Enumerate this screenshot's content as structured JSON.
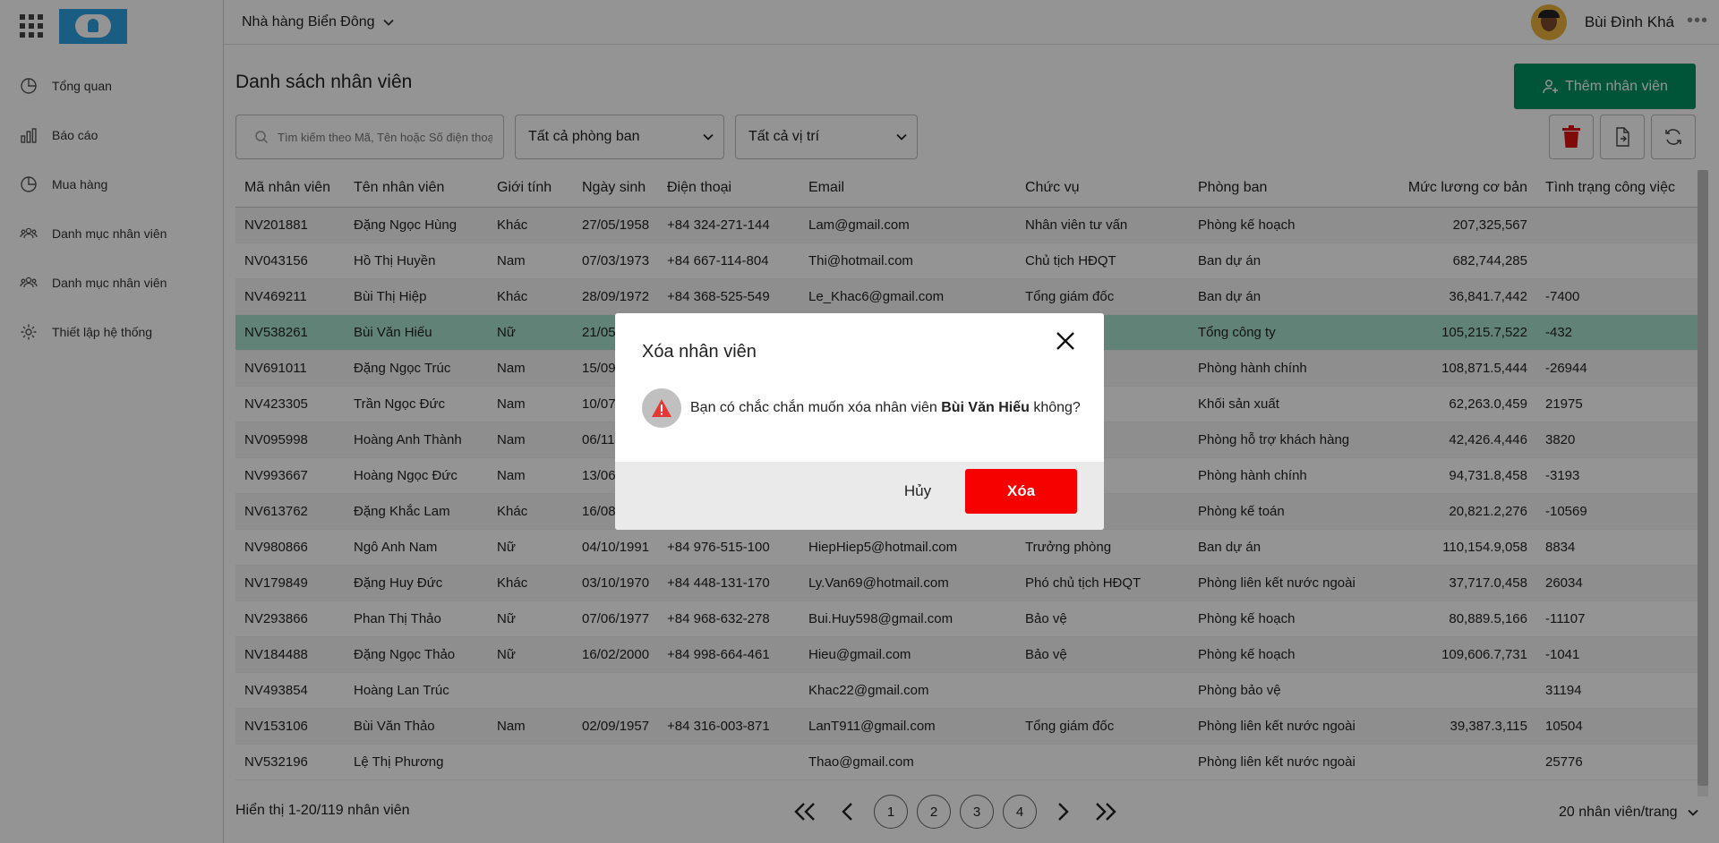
{
  "sidebar": {
    "items": [
      {
        "label": "Tổng quan",
        "icon": "pie-chart-icon"
      },
      {
        "label": "Báo cáo",
        "icon": "bar-chart-icon"
      },
      {
        "label": "Mua hàng",
        "icon": "pie-chart-icon"
      },
      {
        "label": "Danh mục nhân viên",
        "icon": "users-icon"
      },
      {
        "label": "Danh mục nhân viên",
        "icon": "users-icon"
      },
      {
        "label": "Thiết lập hệ thống",
        "icon": "gear-icon"
      }
    ]
  },
  "header": {
    "store_name": "Nhà hàng Biển Đông",
    "user_name": "Bùi Đình Khá",
    "more": "•••"
  },
  "main": {
    "title": "Danh sách nhân viên",
    "add_button": "Thêm nhân viên",
    "search_placeholder": "Tìm kiếm theo Mã, Tên hoặc Số điện thoại",
    "department_filter": "Tất cả phòng ban",
    "position_filter": "Tất cả vị trí"
  },
  "table": {
    "columns": [
      "Mã nhân viên",
      "Tên nhân viên",
      "Giới tính",
      "Ngày sinh",
      "Điện thoại",
      "Email",
      "Chức vụ",
      "Phòng ban",
      "Mức lương cơ bản",
      "Tình trạng công việc"
    ],
    "rows": [
      [
        "NV201881",
        "Đặng Ngọc Hùng",
        "Khác",
        "27/05/1958",
        "+84 324-271-144",
        "Lam@gmail.com",
        "Nhân viên tư vấn",
        "Phòng kế hoạch",
        "207,325,567",
        ""
      ],
      [
        "NV043156",
        "Hồ Thị Huyền",
        "Nam",
        "07/03/1973",
        "+84 667-114-804",
        "Thi@hotmail.com",
        "Chủ tịch HĐQT",
        "Ban dự án",
        "682,744,285",
        ""
      ],
      [
        "NV469211",
        "Bùi Thị Hiệp",
        "Khác",
        "28/09/1972",
        "+84 368-525-549",
        "Le_Khac6@gmail.com",
        "Tổng giám đốc",
        "Ban dự án",
        "36,841.7,442",
        "-7400"
      ],
      [
        "NV538261",
        "Bùi Văn Hiếu",
        "Nữ",
        "21/05",
        "",
        "",
        "yển dụng",
        "Tổng công ty",
        "105,215.7,522",
        "-432"
      ],
      [
        "NV691011",
        "Đặng Ngọc Trúc",
        "Nam",
        "15/09",
        "",
        "",
        "an xuất",
        "Phòng hành chính",
        "108,871.5,444",
        "-26944"
      ],
      [
        "NV423305",
        "Trần Ngọc Đức",
        "Nam",
        "10/07",
        "",
        "",
        "iển khai",
        "Khối sản xuất",
        "62,263.0,459",
        "21975"
      ],
      [
        "NV095998",
        "Hoàng Anh Thành",
        "Nam",
        "06/11",
        "",
        "",
        "ốc",
        "Phòng hỗ trợ khách hàng",
        "42,426.4,446",
        "3820"
      ],
      [
        "NV993667",
        "Hoàng Ngọc Đức",
        "Nam",
        "13/06",
        "",
        "",
        "ốc",
        "Phòng hành chính",
        "94,731.8,458",
        "-3193"
      ],
      [
        "NV613762",
        "Đặng Khắc Lam",
        "Khác",
        "16/08",
        "",
        "",
        "an xuất",
        "Phòng kế toán",
        "20,821.2,276",
        "-10569"
      ],
      [
        "NV980866",
        "Ngô Anh Nam",
        "Nữ",
        "04/10/1991",
        "+84 976-515-100",
        "HiepHiep5@hotmail.com",
        "Trưởng phòng",
        "Ban dự án",
        "110,154.9,058",
        "8834"
      ],
      [
        "NV179849",
        "Đặng Huy Đức",
        "Khác",
        "03/10/1970",
        "+84 448-131-170",
        "Ly.Van69@hotmail.com",
        "Phó chủ tịch HĐQT",
        "Phòng liên kết nước ngoài",
        "37,717.0,458",
        "26034"
      ],
      [
        "NV293866",
        "Phan Thị Thảo",
        "Nữ",
        "07/06/1977",
        "+84 968-632-278",
        "Bui.Huy598@gmail.com",
        "Bảo vệ",
        "Phòng kế hoạch",
        "80,889.5,166",
        "-11107"
      ],
      [
        "NV184488",
        "Đặng Ngọc Thảo",
        "Nữ",
        "16/02/2000",
        "+84 998-664-461",
        "Hieu@gmail.com",
        "Bảo vệ",
        "Phòng kế hoạch",
        "109,606.7,731",
        "-1041"
      ],
      [
        "NV493854",
        "Hoàng Lan Trúc",
        "",
        "",
        "",
        "Khac22@gmail.com",
        "",
        "Phòng bảo vệ",
        "",
        "31194"
      ],
      [
        "NV153106",
        "Bùi Văn Thảo",
        "Nam",
        "02/09/1957",
        "+84 316-003-871",
        "LanT911@gmail.com",
        "Tổng giám đốc",
        "Phòng liên kết nước ngoài",
        "39,387.3,115",
        "10504"
      ],
      [
        "NV532196",
        "Lệ Thị Phương",
        "",
        "",
        "",
        "Thao@gmail.com",
        "",
        "Phòng liên kết nước ngoài",
        "",
        "25776"
      ]
    ],
    "selected_row": 3
  },
  "footer": {
    "info": "Hiển thị 1-20/119 nhân viên",
    "pages": [
      "1",
      "2",
      "3",
      "4"
    ],
    "per_page": "20 nhân viên/trang"
  },
  "dialog": {
    "title": "Xóa nhân viên",
    "message_before": "Bạn có chắc chắn muốn xóa nhân viên ",
    "employee_name": "Bùi Văn Hiếu",
    "message_after": " không?",
    "cancel": "Hủy",
    "confirm": "Xóa"
  },
  "colors": {
    "primary_green": "#019160",
    "danger_red": "#f70000",
    "selected_row": "#a7e0cb"
  }
}
